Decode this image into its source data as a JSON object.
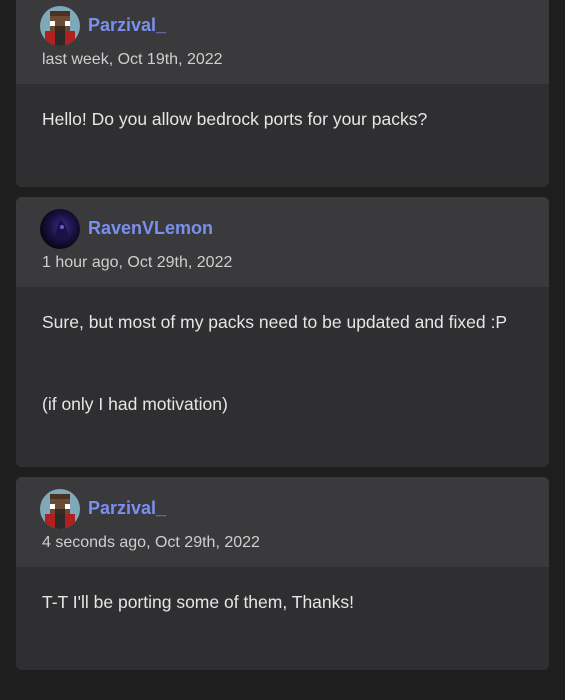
{
  "comments": [
    {
      "username": "Parzival_",
      "timestamp": "last week, Oct 19th, 2022",
      "avatar_icon": "minecraft-skin-avatar-icon",
      "paragraphs": [
        "Hello! Do you allow bedrock ports for your packs?"
      ]
    },
    {
      "username": "RavenVLemon",
      "timestamp": "1 hour ago, Oct 29th, 2022",
      "avatar_icon": "raven-avatar-icon",
      "paragraphs": [
        "Sure, but most of my packs need to be updated and fixed :P",
        "(if only I had motivation)"
      ]
    },
    {
      "username": "Parzival_",
      "timestamp": "4 seconds ago, Oct 29th, 2022",
      "avatar_icon": "minecraft-skin-avatar-icon",
      "paragraphs": [
        "T-T I'll be porting some of them, Thanks!"
      ]
    }
  ],
  "colors": {
    "page_background": "#1e1e1f",
    "card_background": "#2f2f31",
    "header_background": "#3a3a3c",
    "username": "#7a8ff0",
    "timestamp": "#cfcfcf",
    "body_text": "#e6e6e6"
  }
}
